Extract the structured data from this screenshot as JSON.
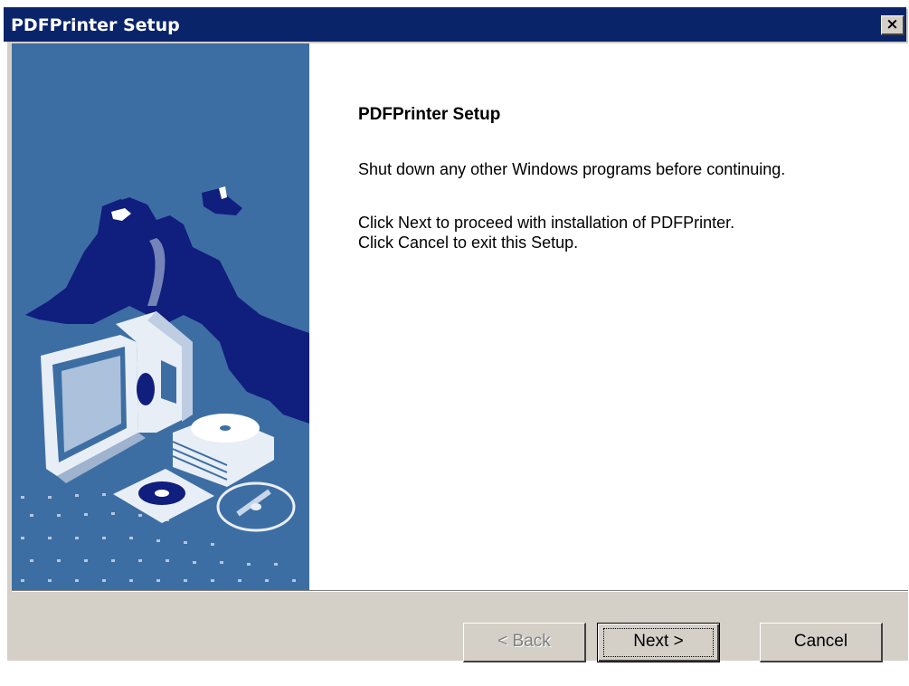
{
  "window": {
    "title": "PDFPrinter Setup",
    "close_glyph": "×"
  },
  "content": {
    "heading": "PDFPrinter Setup",
    "line1": "Shut down any other Windows programs before continuing.",
    "line2": "Click Next to proceed with installation of PDFPrinter.",
    "line3": "Click Cancel to exit this Setup."
  },
  "buttons": {
    "back": "< Back",
    "next": "Next >",
    "cancel": "Cancel"
  },
  "side_image": {
    "icon": "computer-with-discs-illustration"
  },
  "colors": {
    "titlebar": "#0a246a",
    "side_panel": "#3d6ea3",
    "dialog_face": "#d4d0c8"
  }
}
